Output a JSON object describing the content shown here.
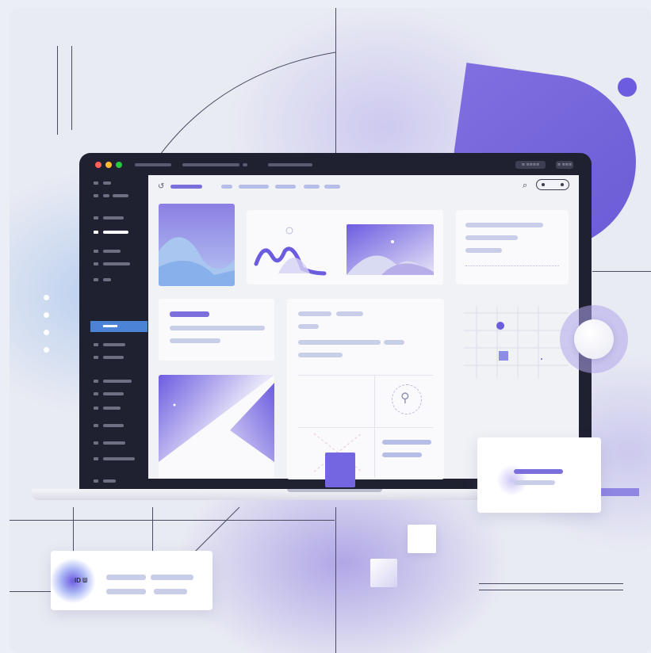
{
  "colors": {
    "accent": "#6c5ce0",
    "sidebar_selected": "#4b84d6",
    "window_dark": "#1f2030",
    "screen_bg": "#f1f2f6"
  },
  "window": {
    "traffic_lights": [
      "#ff5f57",
      "#febc2e",
      "#28c840"
    ],
    "title_pills": [
      "≡ ≡≡≡≡",
      "≡ ≡≡≡"
    ]
  },
  "toolbar": {
    "logo_glyph": "↺",
    "search_glyph": "⌕"
  },
  "card_icon": {
    "pin_glyph": "⚲"
  },
  "badge": {
    "text": "ID ᗯ"
  },
  "icons": [
    "search-icon",
    "toggle-icon",
    "location-pin-icon",
    "logo-icon"
  ]
}
